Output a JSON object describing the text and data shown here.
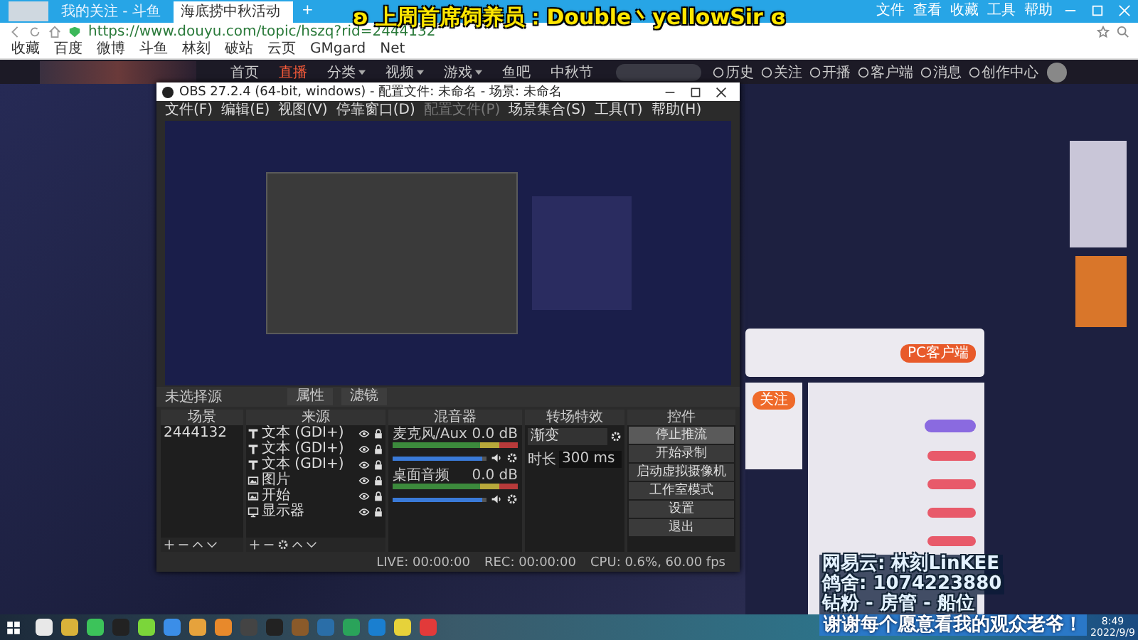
{
  "browser": {
    "tabs": [
      {
        "label": "我的关注 - 斗鱼",
        "selected": false
      },
      {
        "label": "海底捞中秋活动",
        "selected": true
      }
    ],
    "new_tab": "+",
    "menu": [
      "文件",
      "查看",
      "收藏",
      "工具",
      "帮助"
    ],
    "address": "https://www.douyu.com/topic/hszq?rid=2444132",
    "bookmarks": [
      "收藏",
      "百度",
      "微博",
      "斗鱼",
      "林刻",
      "破站",
      "云页",
      "GMgard",
      "Net"
    ]
  },
  "site_nav": {
    "items": [
      {
        "label": "首页",
        "selected": false,
        "dropdown": false
      },
      {
        "label": "直播",
        "selected": true,
        "dropdown": false
      },
      {
        "label": "分类",
        "selected": false,
        "dropdown": true
      },
      {
        "label": "视频",
        "selected": false,
        "dropdown": true
      },
      {
        "label": "游戏",
        "selected": false,
        "dropdown": true
      },
      {
        "label": "鱼吧",
        "selected": false,
        "dropdown": false
      },
      {
        "label": "中秋节",
        "selected": false,
        "dropdown": false
      }
    ],
    "actions": [
      "历史",
      "关注",
      "开播",
      "客户端",
      "消息",
      "创作中心"
    ]
  },
  "obs": {
    "title": "OBS 27.2.4 (64-bit, windows) - 配置文件: 未命名 - 场景: 未命名",
    "menu": [
      {
        "label": "文件(F)",
        "disabled": false
      },
      {
        "label": "编辑(E)",
        "disabled": false
      },
      {
        "label": "视图(V)",
        "disabled": false
      },
      {
        "label": "停靠窗口(D)",
        "disabled": false
      },
      {
        "label": "配置文件(P)",
        "disabled": true
      },
      {
        "label": "场景集合(S)",
        "disabled": false
      },
      {
        "label": "工具(T)",
        "disabled": false
      },
      {
        "label": "帮助(H)",
        "disabled": false
      }
    ],
    "source_bar": {
      "label": "未选择源",
      "buttons": [
        "属性",
        "滤镜"
      ]
    },
    "scenes": {
      "title": "场景",
      "items": [
        "2444132"
      ]
    },
    "sources": {
      "title": "来源",
      "items": [
        {
          "kind": "text",
          "label": "文本 (GDI+)"
        },
        {
          "kind": "text",
          "label": "文本 (GDI+)"
        },
        {
          "kind": "text",
          "label": "文本 (GDI+)"
        },
        {
          "kind": "image",
          "label": "图片"
        },
        {
          "kind": "image",
          "label": "开始"
        },
        {
          "kind": "display",
          "label": "显示器"
        }
      ]
    },
    "mixer": {
      "title": "混音器",
      "channels": [
        {
          "name": "麦克风/Aux",
          "reading": "0.0 dB",
          "level": 0.95
        },
        {
          "name": "桌面音频",
          "reading": "0.0 dB",
          "level": 0.95
        }
      ]
    },
    "transitions": {
      "title": "转场特效",
      "type": "渐变",
      "duration_label": "时长",
      "duration": "300 ms"
    },
    "controls": {
      "title": "控件",
      "buttons": [
        {
          "label": "停止推流",
          "highlighted": true
        },
        {
          "label": "开始录制",
          "highlighted": false
        },
        {
          "label": "启动虚拟摄像机",
          "highlighted": false
        },
        {
          "label": "工作室模式",
          "highlighted": false
        },
        {
          "label": "设置",
          "highlighted": false
        },
        {
          "label": "退出",
          "highlighted": false
        }
      ]
    },
    "status": {
      "live": "LIVE: 00:00:00",
      "rec": "REC: 00:00:00",
      "cpu": "CPU: 0.6%, 60.00 fps"
    }
  },
  "room_panel": {
    "pc_client": "PC客户端",
    "follow": "关注"
  },
  "overlay": {
    "top": "ʚ 上周首席饲养员：Double丶yellowSir ɞ",
    "lines": [
      "网易云: 林刻LinKEE",
      "鸽舍: 1074223880",
      "钻粉 - 房管 - 船位"
    ],
    "thanks": "谢谢每个愿意看我的观众老爷！"
  },
  "taskbar": {
    "time": "8:49",
    "date": "2022/9/9"
  }
}
